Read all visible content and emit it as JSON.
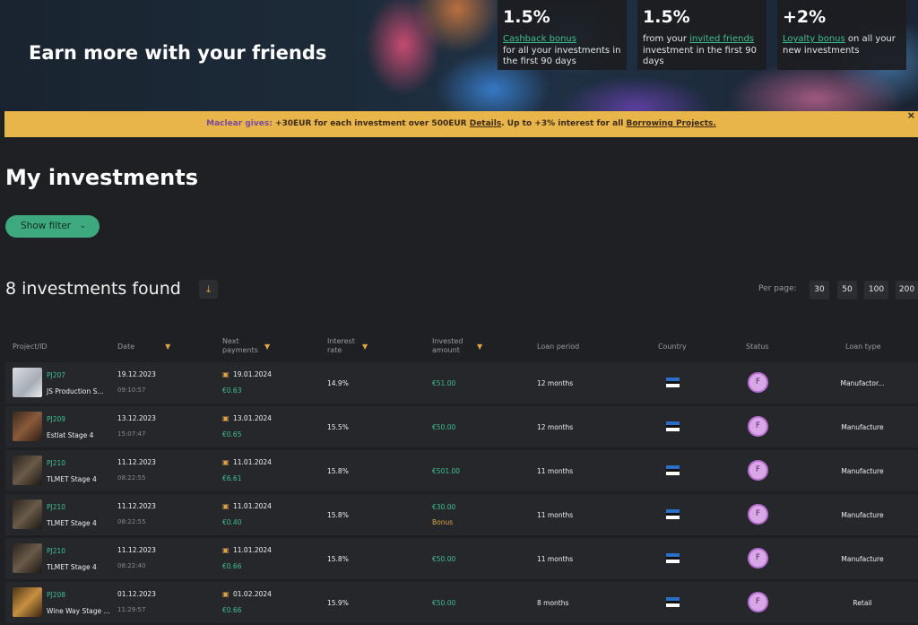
{
  "banner": {
    "title": "Earn more with your friends",
    "stats": [
      {
        "value": "1.5%",
        "link": "Cashback bonus",
        "text_after": "for all your investments in the first 90 days"
      },
      {
        "value": "1.5%",
        "text_before": "from your ",
        "link": "invited friends",
        "text_after": " investment in the first 90 days"
      },
      {
        "value": "+2%",
        "link": "Loyalty bonus",
        "text_after": " on all your new investments"
      }
    ]
  },
  "promo": {
    "brand": "Maclear gives:",
    "text1": " +30EUR for each investment over 500EUR ",
    "link1": "Details",
    "text2": ". Up to +3% interest for all ",
    "link2": "Borrowing Projects.",
    "close": "×"
  },
  "page_title": "My investments",
  "filter_button": {
    "label": "Show filter",
    "chevron": "⌄"
  },
  "results": {
    "count_text": "8 investments found",
    "download_icon": "⤓"
  },
  "per_page": {
    "label": "Per page:",
    "options": [
      "30",
      "50",
      "100",
      "200"
    ]
  },
  "columns": {
    "project": "Project/ID",
    "date": "Date",
    "next1": "Next",
    "next2": "payments",
    "rate1": "Interest",
    "rate2": "rate",
    "amt1": "Invested",
    "amt2": "amount",
    "period": "Loan period",
    "country": "Country",
    "status": "Status",
    "type": "Loan type",
    "sort_icon": "▼"
  },
  "rows": [
    {
      "id": "PJ207",
      "name": "JS Production S...",
      "date": "19.12.2023",
      "time": "09:10:57",
      "next_date": "19.01.2024",
      "next_amount": "€0.63",
      "rate": "14.9%",
      "amount": "€51.00",
      "bonus": "",
      "period": "12 months",
      "status": "F",
      "type": "Manufactor..."
    },
    {
      "id": "PJ209",
      "name": "Estlat Stage 4",
      "date": "13.12.2023",
      "time": "15:07:47",
      "next_date": "13.01.2024",
      "next_amount": "€0.65",
      "rate": "15.5%",
      "amount": "€50.00",
      "bonus": "",
      "period": "12 months",
      "status": "F",
      "type": "Manufacture"
    },
    {
      "id": "PJ210",
      "name": "TLMET Stage 4",
      "date": "11.12.2023",
      "time": "08:22:55",
      "next_date": "11.01.2024",
      "next_amount": "€6.61",
      "rate": "15.8%",
      "amount": "€501.00",
      "bonus": "",
      "period": "11 months",
      "status": "F",
      "type": "Manufacture"
    },
    {
      "id": "PJ210",
      "name": "TLMET Stage 4",
      "date": "11.12.2023",
      "time": "08:22:55",
      "next_date": "11.01.2024",
      "next_amount": "€0.40",
      "rate": "15.8%",
      "amount": "€30.00",
      "bonus": "Bonus",
      "period": "11 months",
      "status": "F",
      "type": "Manufacture"
    },
    {
      "id": "PJ210",
      "name": "TLMET Stage 4",
      "date": "11.12.2023",
      "time": "08:22:40",
      "next_date": "11.01.2024",
      "next_amount": "€0.66",
      "rate": "15.8%",
      "amount": "€50.00",
      "bonus": "",
      "period": "11 months",
      "status": "F",
      "type": "Manufacture"
    },
    {
      "id": "PJ208",
      "name": "Wine Way Stage ...",
      "date": "01.12.2023",
      "time": "11:29:57",
      "next_date": "01.02.2024",
      "next_amount": "€0.66",
      "rate": "15.9%",
      "amount": "€50.00",
      "bonus": "",
      "period": "8 months",
      "status": "F",
      "type": "Retail"
    }
  ],
  "colors": {
    "accent_green": "#3fbf8f",
    "accent_orange": "#e0a54a",
    "promo_bg": "#e8b54a",
    "badge_purple": "#d9a6e6",
    "flag_blue": "#2a6ec7"
  }
}
